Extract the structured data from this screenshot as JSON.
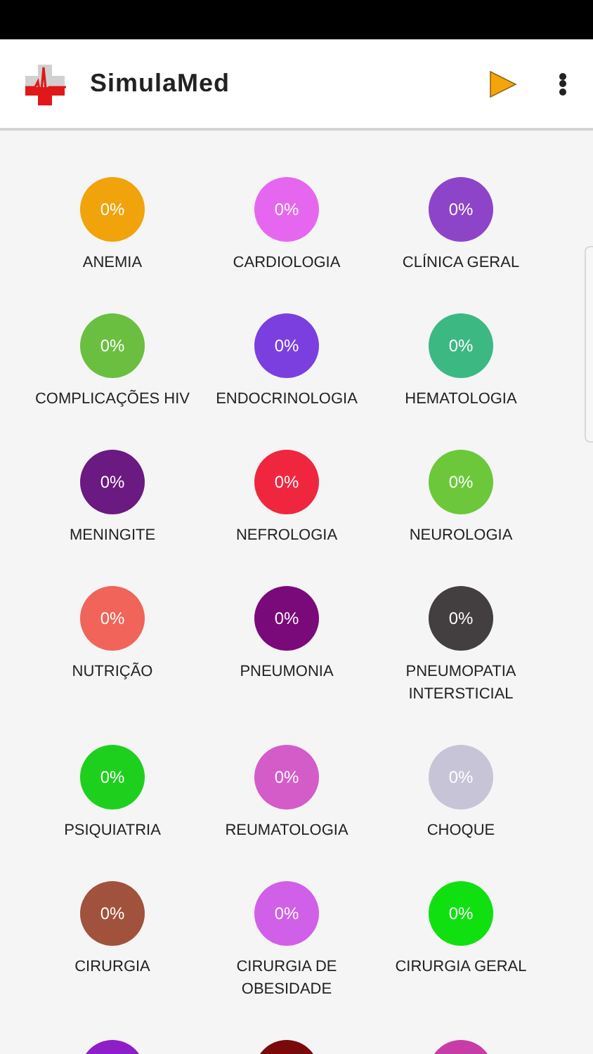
{
  "app_bar": {
    "title": "SimulaMed"
  },
  "specialties": [
    {
      "name": "ANEMIA",
      "percent": "0%",
      "color": "#f0a30a"
    },
    {
      "name": "CARDIOLOGIA",
      "percent": "0%",
      "color": "#e667ef"
    },
    {
      "name": "CLÍNICA GERAL",
      "percent": "0%",
      "color": "#8e44c8"
    },
    {
      "name": "COMPLICAÇÕES HIV",
      "percent": "0%",
      "color": "#6abf40"
    },
    {
      "name": "ENDOCRINOLOGIA",
      "percent": "0%",
      "color": "#7b3fe0"
    },
    {
      "name": "HEMATOLOGIA",
      "percent": "0%",
      "color": "#3cb883"
    },
    {
      "name": "MENINGITE",
      "percent": "0%",
      "color": "#6a1a80"
    },
    {
      "name": "NEFROLOGIA",
      "percent": "0%",
      "color": "#f0263f"
    },
    {
      "name": "NEUROLOGIA",
      "percent": "0%",
      "color": "#6cc83a"
    },
    {
      "name": "NUTRIÇÃO",
      "percent": "0%",
      "color": "#f0645a"
    },
    {
      "name": "PNEUMONIA",
      "percent": "0%",
      "color": "#7a0a7a"
    },
    {
      "name": "PNEUMOPATIA INTERSTICIAL",
      "percent": "0%",
      "color": "#433e40"
    },
    {
      "name": "PSIQUIATRIA",
      "percent": "0%",
      "color": "#1ed01e"
    },
    {
      "name": "REUMATOLOGIA",
      "percent": "0%",
      "color": "#d45cc8"
    },
    {
      "name": "CHOQUE",
      "percent": "0%",
      "color": "#c8c4d8"
    },
    {
      "name": "CIRURGIA",
      "percent": "0%",
      "color": "#a0523c"
    },
    {
      "name": "CIRURGIA DE OBESIDADE",
      "percent": "0%",
      "color": "#d060e8"
    },
    {
      "name": "CIRURGIA GERAL",
      "percent": "0%",
      "color": "#10e010"
    },
    {
      "color": "#8e1ec8"
    },
    {
      "color": "#7a0a0a"
    },
    {
      "color": "#c83ca8"
    }
  ]
}
